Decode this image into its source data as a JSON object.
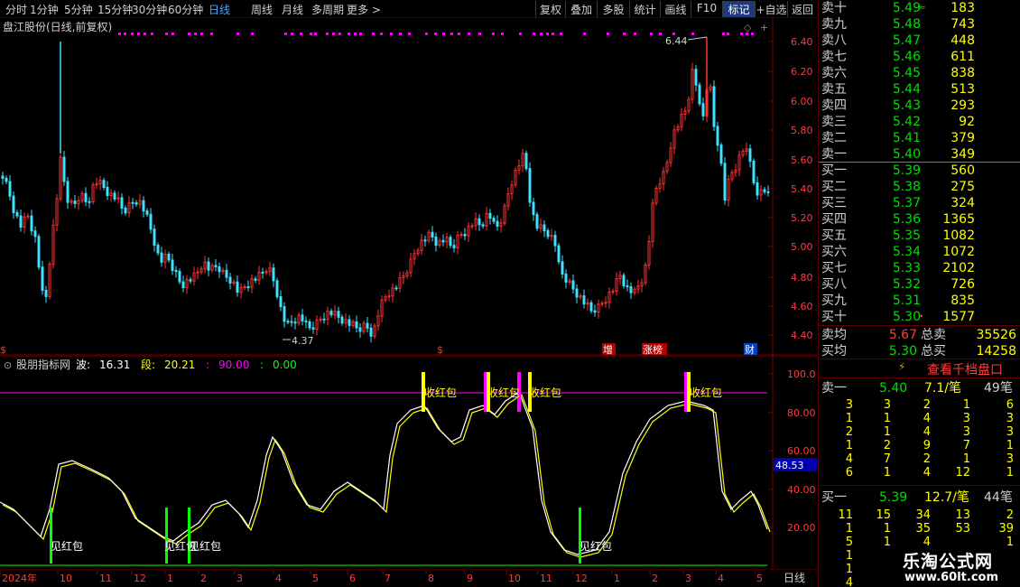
{
  "toolbar": {
    "periods": [
      "分时",
      "1分钟",
      "5分钟",
      "15分钟",
      "30分钟",
      "60分钟",
      "日线",
      "周线",
      "月线",
      "多周期",
      "更多 >"
    ],
    "active_period": "日线",
    "tools": [
      "复权",
      "叠加",
      "多股",
      "统计",
      "画线",
      "F10",
      "标记",
      "+自选",
      "返回"
    ],
    "active_tool": "标记"
  },
  "main_chart": {
    "title": "盘江股份(日线,前复权)",
    "y_ticks": [
      "6.40",
      "6.20",
      "6.00",
      "5.80",
      "5.60",
      "5.40",
      "5.20",
      "5.00",
      "4.80",
      "4.60",
      "4.40"
    ],
    "high_label": "6.44",
    "low_label": "4.37",
    "bottom_markers": [
      "$",
      "$",
      "增",
      "涨榜",
      "财"
    ],
    "colors": {
      "up": "#ff3232",
      "down": "#40e0ff",
      "purple": "#ff00ff"
    }
  },
  "indicator": {
    "name": "股朋指标网",
    "params": [
      {
        "label": "波:",
        "value": "16.31",
        "color": "#ffffff"
      },
      {
        "label": "段:",
        "value": "20.21",
        "color": "#ffff00"
      },
      {
        "label": ":",
        "value": "90.00",
        "color": "#ff00ff"
      },
      {
        "label": ":",
        "value": "0.00",
        "color": "#00ff00"
      }
    ],
    "y_ticks": [
      "100.0",
      "80.00",
      "60.00",
      "40.00",
      "20.00"
    ],
    "current_value": "48.53",
    "signals_sell": [
      "收红包",
      "收红包",
      "收红包",
      "收红包"
    ],
    "signals_buy": [
      "见红包",
      "见红包",
      "见红包",
      "见红包"
    ]
  },
  "date_axis": {
    "labels": [
      "2024年",
      "10",
      "11",
      "12",
      "1",
      "2",
      "3",
      "4",
      "5",
      "6",
      "7",
      "8",
      "9",
      "10",
      "11",
      "12",
      "1",
      "2",
      "3",
      "4",
      "5"
    ],
    "period": "日线"
  },
  "order_book": {
    "asks": [
      {
        "label": "卖十",
        "price": "5.49",
        "vol": "183",
        "mark": "≈"
      },
      {
        "label": "卖九",
        "price": "5.48",
        "vol": "743"
      },
      {
        "label": "卖八",
        "price": "5.47",
        "vol": "448"
      },
      {
        "label": "卖七",
        "price": "5.46",
        "vol": "611"
      },
      {
        "label": "卖六",
        "price": "5.45",
        "vol": "838"
      },
      {
        "label": "卖五",
        "price": "5.44",
        "vol": "513"
      },
      {
        "label": "卖四",
        "price": "5.43",
        "vol": "293"
      },
      {
        "label": "卖三",
        "price": "5.42",
        "vol": "92"
      },
      {
        "label": "卖二",
        "price": "5.41",
        "vol": "379"
      },
      {
        "label": "卖一",
        "price": "5.40",
        "vol": "349"
      }
    ],
    "bids": [
      {
        "label": "买一",
        "price": "5.39",
        "vol": "560"
      },
      {
        "label": "买二",
        "price": "5.38",
        "vol": "275"
      },
      {
        "label": "买三",
        "price": "5.37",
        "vol": "324"
      },
      {
        "label": "买四",
        "price": "5.36",
        "vol": "1365"
      },
      {
        "label": "买五",
        "price": "5.35",
        "vol": "1082"
      },
      {
        "label": "买六",
        "price": "5.34",
        "vol": "1072"
      },
      {
        "label": "买七",
        "price": "5.33",
        "vol": "2102"
      },
      {
        "label": "买八",
        "price": "5.32",
        "vol": "726"
      },
      {
        "label": "买九",
        "price": "5.31",
        "vol": "835"
      },
      {
        "label": "买十",
        "price": "5.30",
        "vol": "1577",
        "mark": "•"
      }
    ],
    "sell_avg": {
      "label": "卖均",
      "price": "5.67",
      "total_label": "总卖",
      "total": "35526"
    },
    "buy_avg": {
      "label": "买均",
      "price": "5.30",
      "total_label": "总买",
      "total": "14258"
    },
    "qiandang_label": "查看千档盘口",
    "sell1": {
      "label": "卖一",
      "price": "5.40",
      "avg": "7.1/笔",
      "count": "49笔"
    },
    "sell1_grid": [
      [
        "3",
        "3",
        "2",
        "1",
        "6"
      ],
      [
        "1",
        "1",
        "4",
        "3",
        "3"
      ],
      [
        "2",
        "1",
        "4",
        "3",
        "3"
      ],
      [
        "1",
        "2",
        "9",
        "7",
        "1"
      ],
      [
        "4",
        "7",
        "2",
        "1",
        "3"
      ],
      [
        "6",
        "1",
        "4",
        "12",
        "1"
      ]
    ],
    "buy1": {
      "label": "买一",
      "price": "5.39",
      "avg": "12.7/笔",
      "count": "44笔"
    },
    "buy1_grid": [
      [
        "11",
        "15",
        "34",
        "13",
        "2"
      ],
      [
        "1",
        "1",
        "35",
        "53",
        "39"
      ],
      [
        "5",
        "1",
        "4",
        "",
        "1"
      ],
      [
        "1",
        "",
        "",
        "",
        ""
      ],
      [
        "1",
        "",
        "",
        "",
        ""
      ],
      [
        "4",
        "",
        "",
        "",
        ""
      ]
    ]
  },
  "watermark": {
    "title": "乐淘公式网",
    "url": "www.60lt.com"
  }
}
